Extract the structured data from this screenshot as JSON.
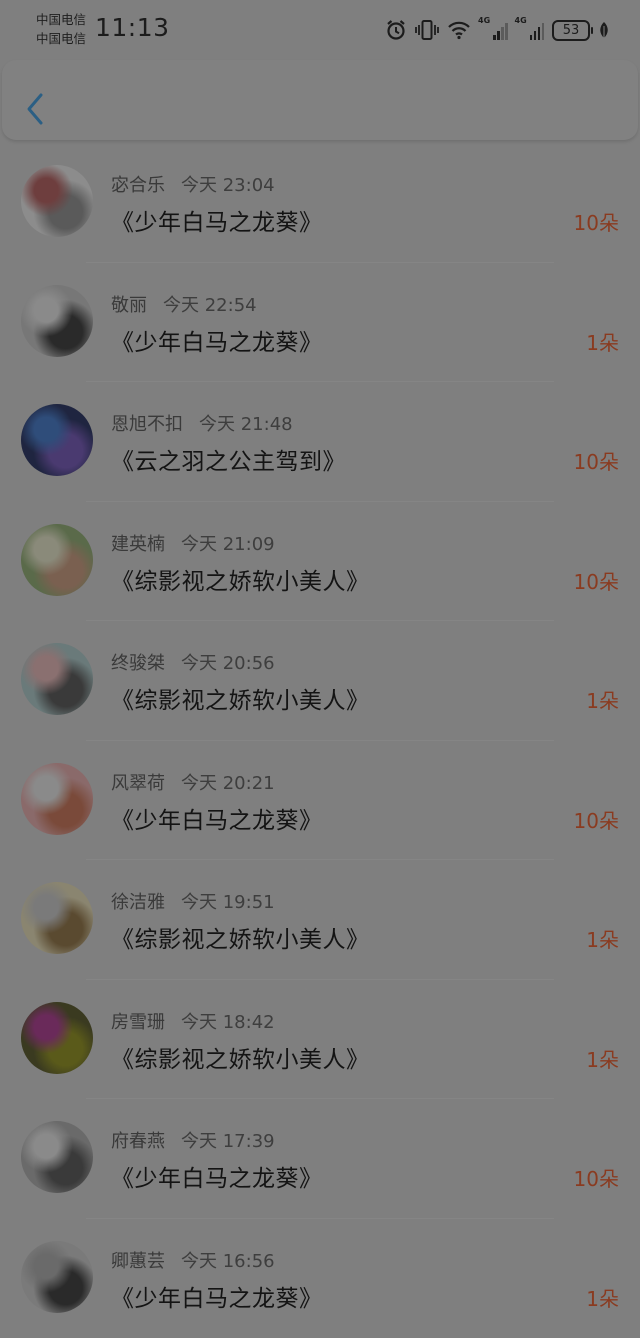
{
  "status_bar": {
    "carrier_1": "中国电信",
    "carrier_2": "中国电信",
    "time": "11:13",
    "network_1": "4G",
    "network_2": "4G",
    "battery": "53",
    "icons": [
      "alarm-icon",
      "vibrate-icon",
      "wifi-icon",
      "signal-icon",
      "signal-icon",
      "battery-icon",
      "leaf-icon"
    ]
  },
  "nav": {
    "back_icon": "chevron-left-icon",
    "accent_color": "#2b5f84"
  },
  "colors": {
    "count": "#8a3b20"
  },
  "records": [
    {
      "name": "宓合乐",
      "time": "今天 23:04",
      "title": "《少年白马之龙葵》",
      "count": "10朵",
      "avatar": [
        "#8c8c8c",
        "#5a5a5a",
        "#6e3e3e"
      ]
    },
    {
      "name": "敬丽",
      "time": "今天 22:54",
      "title": "《少年白马之龙葵》",
      "count": "1朵",
      "avatar": [
        "#777777",
        "#2a2a2a",
        "#8a8a8a"
      ]
    },
    {
      "name": "恩旭不扣",
      "time": "今天 21:48",
      "title": "《云之羽之公主驾到》",
      "count": "10朵",
      "avatar": [
        "#1f2540",
        "#4a3a70",
        "#2f4d7a"
      ]
    },
    {
      "name": "建英楠",
      "time": "今天 21:09",
      "title": "《综影视之娇软小美人》",
      "count": "10朵",
      "avatar": [
        "#5a6a4a",
        "#7a6050",
        "#8a8a7a"
      ]
    },
    {
      "name": "终骏桀",
      "time": "今天 20:56",
      "title": "《综影视之娇软小美人》",
      "count": "1朵",
      "avatar": [
        "#6a7a7a",
        "#3a3a3a",
        "#8a7070"
      ]
    },
    {
      "name": "风翠荷",
      "time": "今天 20:21",
      "title": "《少年白马之龙葵》",
      "count": "10朵",
      "avatar": [
        "#8a6a6a",
        "#7a4a3a",
        "#8a8a8a"
      ]
    },
    {
      "name": "徐洁雅",
      "time": "今天 19:51",
      "title": "《综影视之娇软小美人》",
      "count": "1朵",
      "avatar": [
        "#8a8570",
        "#5a4a30",
        "#7a7a7a"
      ]
    },
    {
      "name": "房雪珊",
      "time": "今天 18:42",
      "title": "《综影视之娇软小美人》",
      "count": "1朵",
      "avatar": [
        "#3a3a20",
        "#5a5a1a",
        "#6a2a5a"
      ]
    },
    {
      "name": "府春燕",
      "time": "今天 17:39",
      "title": "《少年白马之龙葵》",
      "count": "10朵",
      "avatar": [
        "#6a6a6a",
        "#3a3a3a",
        "#8a8a8a"
      ]
    },
    {
      "name": "卿蕙芸",
      "time": "今天 16:56",
      "title": "《少年白马之龙葵》",
      "count": "1朵",
      "avatar": [
        "#7a7a7a",
        "#2a2a2a",
        "#6a6a6a"
      ]
    }
  ]
}
